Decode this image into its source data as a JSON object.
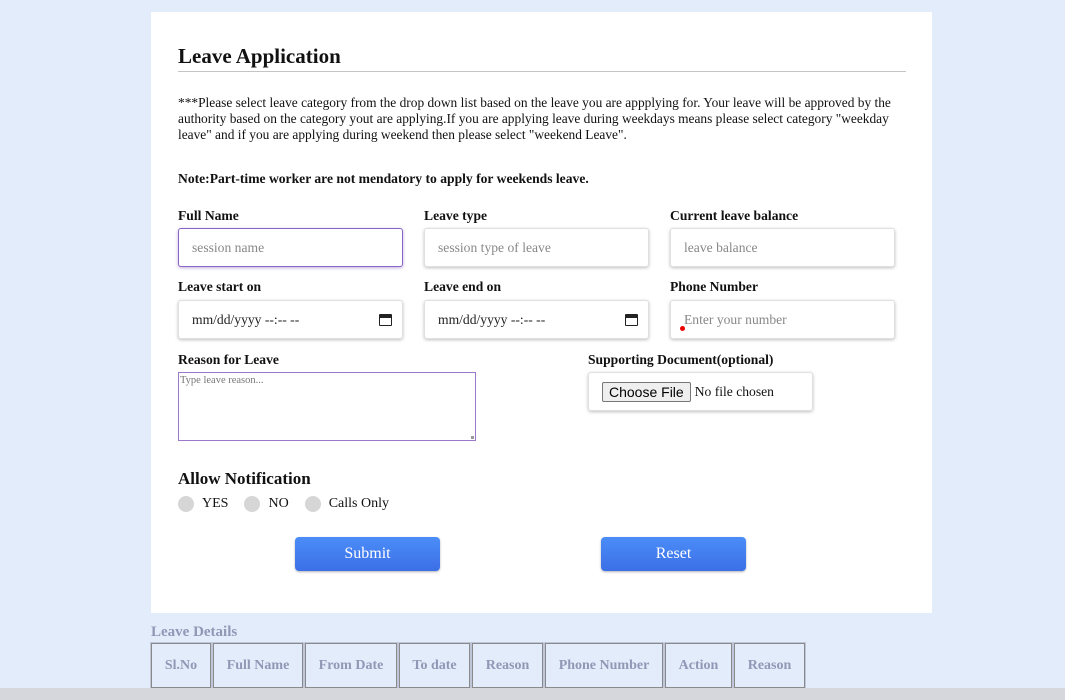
{
  "form": {
    "title": "Leave Application",
    "intro": "***Please select leave category from the drop down list based on the leave you are appplying for. Your leave will be approved by the authority based on the category yout are applying.If you are applying leave during weekdays means please select category \"weekday leave\" and if you are applying during weekend then please select \"weekend Leave\".",
    "note": "Note:Part-time worker are not mendatory to apply for weekends leave.",
    "fields": {
      "full_name": {
        "label": "Full Name",
        "placeholder": "session name"
      },
      "leave_type": {
        "label": "Leave type",
        "placeholder": "session type of leave"
      },
      "leave_balance": {
        "label": "Current leave balance",
        "placeholder": "leave balance"
      },
      "start": {
        "label": "Leave start on",
        "value": "mm/dd/yyyy --:-- --"
      },
      "end": {
        "label": "Leave end on",
        "value": "mm/dd/yyyy --:-- --"
      },
      "phone": {
        "label": "Phone Number",
        "placeholder": "Enter your number"
      },
      "reason": {
        "label": "Reason for Leave",
        "placeholder": "Type leave reason..."
      },
      "document": {
        "label": "Supporting Document(optional)",
        "button": "Choose File",
        "status": "No file chosen"
      }
    },
    "notification": {
      "title": "Allow Notification",
      "options": [
        "YES",
        "NO",
        "Calls Only"
      ]
    },
    "buttons": {
      "submit": "Submit",
      "reset": "Reset"
    }
  },
  "details": {
    "title": "Leave Details",
    "columns": [
      "Sl.No",
      "Full Name",
      "From Date",
      "To date",
      "Reason",
      "Phone Number",
      "Action",
      "Reason"
    ]
  },
  "colors": {
    "page_bg": "#e3ecfb",
    "button_blue": "#4b8df8",
    "focus_purple": "#8b64c7",
    "muted_header": "#8f98b5"
  }
}
